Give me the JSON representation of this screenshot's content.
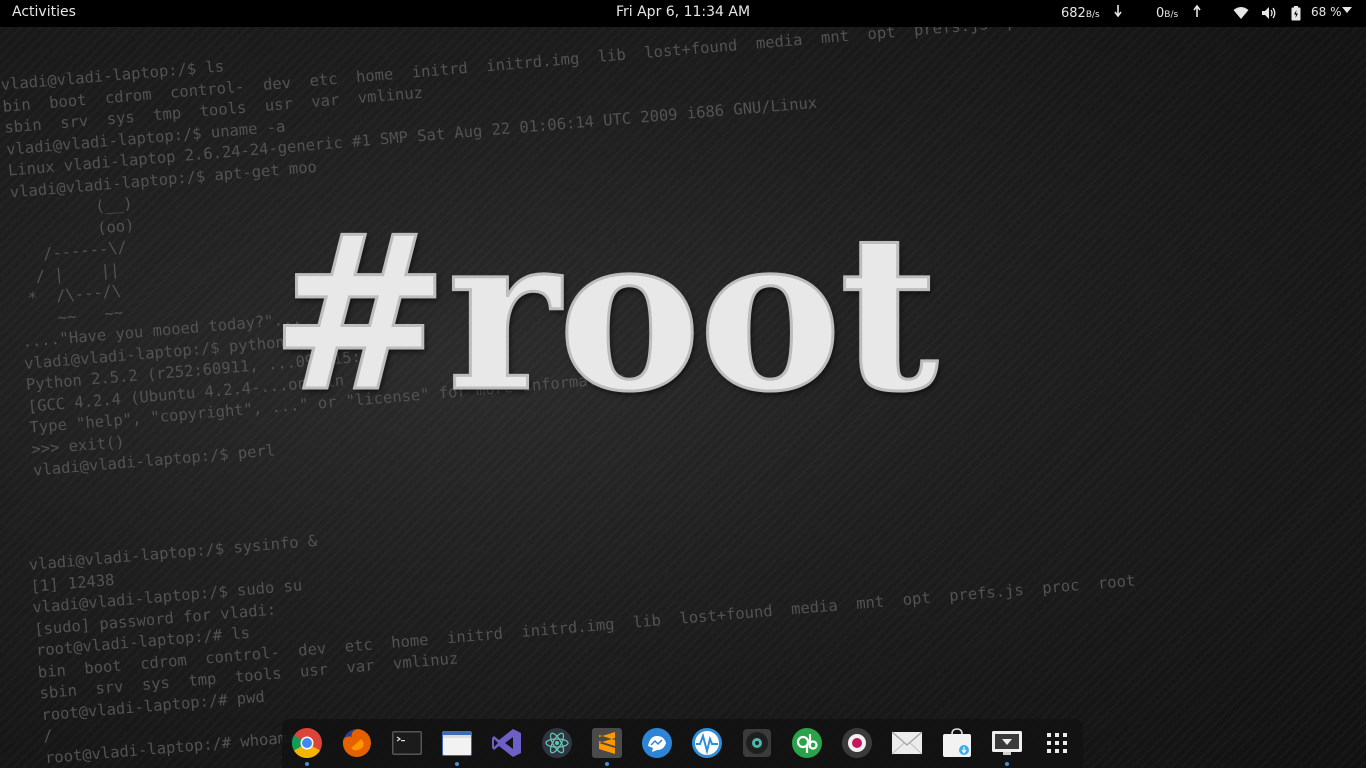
{
  "topbar": {
    "activities_label": "Activities",
    "clock": "Fri Apr  6, 11:34 AM",
    "download_speed": "682",
    "download_unit": "B/s",
    "upload_speed": "0",
    "upload_unit": "B/s",
    "battery_percent": "68 %",
    "icons": [
      "download-arrow-icon",
      "upload-arrow-icon",
      "wifi-icon",
      "volume-icon",
      "battery-icon",
      "system-menu-arrow-icon"
    ]
  },
  "wallpaper": {
    "title": "#root",
    "terminal_top": "vladi@vladi-laptop:/$ ls\nbin  boot  cdrom  control-  dev  etc  home  initrd  initrd.img  lib  lost+found  media  mnt  opt  prefs.js  p\nsbin  srv  sys  tmp  tools  usr  var  vmlinuz\nvladi@vladi-laptop:/$ uname -a\nLinux vladi-laptop 2.6.24-24-generic #1 SMP Sat Aug 22 01:06:14 UTC 2009 i686 GNU/Linux\nvladi@vladi-laptop:/$ apt-get moo\n         (__)\n         (oo)\n   /------\\/\n  / |    ||\n *  /\\---/\\\n    ~~   ~~\n....\"Have you mooed today?\"...\nvladi@vladi-laptop:/$ python\nPython 2.5.2 (r252:60911, ...09, 15:\n[GCC 4.2.4 (Ubuntu 4.2.4-...on lin\nType \"help\", \"copyright\", ...\" or \"license\" for more information.\n>>> exit()\nvladi@vladi-laptop:/$ perl",
    "terminal_bottom": "vladi@vladi-laptop:/$ sysinfo &\n[1] 12438\nvladi@vladi-laptop:/$ sudo su\n[sudo] password for vladi:\nroot@vladi-laptop:/# ls\nbin  boot  cdrom  control-  dev  etc  home  initrd  initrd.img  lib  lost+found  media  mnt  opt  prefs.js  proc  root\nsbin  srv  sys  tmp  tools  usr  var  vmlinuz\nroot@vladi-laptop:/# pwd\n/\nroot@vladi-laptop:/# whoami\nroot"
  },
  "dock": {
    "apps": [
      {
        "name": "Google Chrome",
        "icon": "chrome-icon",
        "running": true
      },
      {
        "name": "Firefox",
        "icon": "firefox-icon",
        "running": false
      },
      {
        "name": "Terminal",
        "icon": "terminal-icon",
        "running": false
      },
      {
        "name": "Files",
        "icon": "files-icon",
        "running": true
      },
      {
        "name": "Visual Studio Code",
        "icon": "vscode-icon",
        "running": false
      },
      {
        "name": "Atom",
        "icon": "atom-icon",
        "running": false
      },
      {
        "name": "Sublime Text",
        "icon": "sublime-icon",
        "running": true
      },
      {
        "name": "Messenger",
        "icon": "messenger-icon",
        "running": false
      },
      {
        "name": "System Monitor",
        "icon": "system-monitor-icon",
        "running": false
      },
      {
        "name": "Disks",
        "icon": "disks-icon",
        "running": false
      },
      {
        "name": "qBittorrent",
        "icon": "qbittorrent-icon",
        "running": false
      },
      {
        "name": "Screen Recorder",
        "icon": "screen-recorder-icon",
        "running": false
      },
      {
        "name": "Mail",
        "icon": "mail-icon",
        "running": false
      },
      {
        "name": "Software",
        "icon": "software-icon",
        "running": false
      },
      {
        "name": "Remote Desktop",
        "icon": "remote-desktop-icon",
        "running": true
      },
      {
        "name": "Show Applications",
        "icon": "app-grid-icon",
        "running": false
      }
    ],
    "colors": {
      "running_dot": "#4a90d9",
      "dock_bg": "#121212"
    }
  }
}
